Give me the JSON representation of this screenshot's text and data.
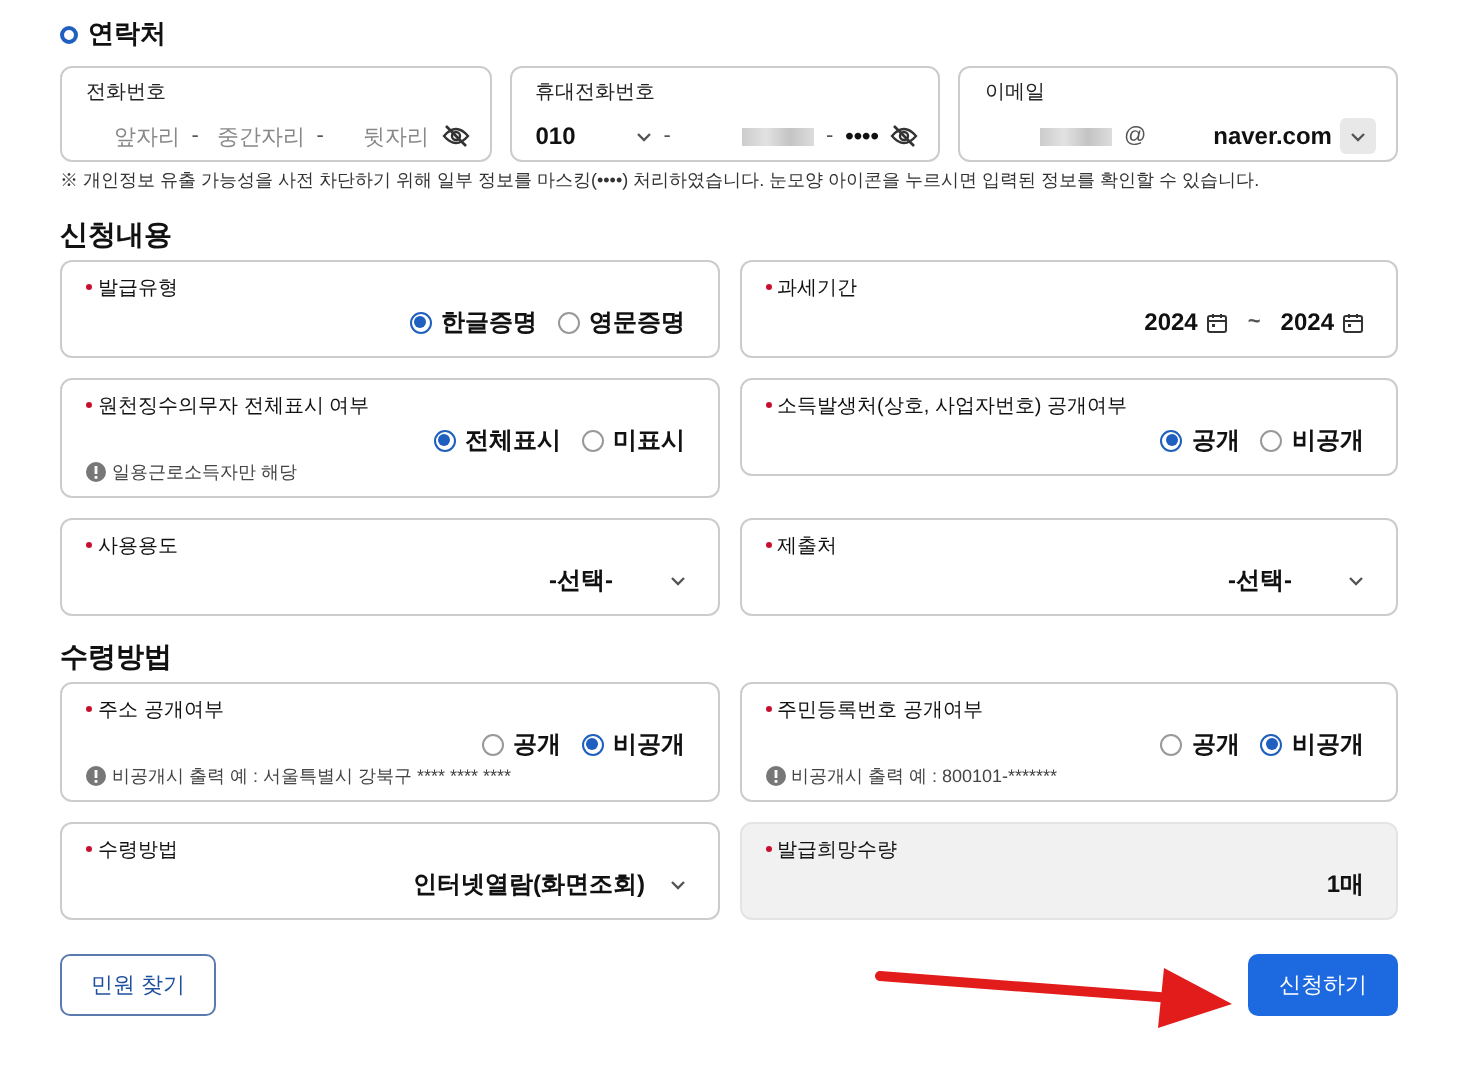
{
  "contact": {
    "title": "연락처",
    "marker": true,
    "fields": [
      {
        "label": "전화번호",
        "segments": [
          {
            "kind": "placeholder",
            "text": "앞자리"
          },
          {
            "kind": "sep",
            "text": "-"
          },
          {
            "kind": "placeholder",
            "text": "중간자리"
          },
          {
            "kind": "sep",
            "text": "-"
          },
          {
            "kind": "placeholder",
            "text": "뒷자리"
          },
          {
            "kind": "eye"
          }
        ]
      },
      {
        "label": "휴대전화번호",
        "segments": [
          {
            "kind": "select",
            "text": "010"
          },
          {
            "kind": "sep",
            "text": "-"
          },
          {
            "kind": "redacted"
          },
          {
            "kind": "sep",
            "text": "-"
          },
          {
            "kind": "value",
            "text": "••••"
          },
          {
            "kind": "eye"
          }
        ]
      },
      {
        "label": "이메일",
        "segments": [
          {
            "kind": "redacted"
          },
          {
            "kind": "sep",
            "text": "@"
          },
          {
            "kind": "domain",
            "text": "naver.com"
          }
        ]
      }
    ],
    "note": "※ 개인정보 유출 가능성을 사전 차단하기 위해 일부 정보를 마스킹(••••) 처리하였습니다. 눈모양 아이콘을 누르시면 입력된 정보를 확인할 수 있습니다."
  },
  "sections": [
    {
      "title": "신청내용",
      "marker": false,
      "cards": [
        {
          "kind": "radio",
          "label": "발급유형",
          "required": true,
          "options": [
            {
              "label": "한글증명",
              "selected": true
            },
            {
              "label": "영문증명",
              "selected": false
            }
          ]
        },
        {
          "kind": "period",
          "label": "과세기간",
          "required": true,
          "from": "2024",
          "sep": "~",
          "to": "2024"
        },
        {
          "kind": "radio",
          "label": "원천징수의무자 전체표시 여부",
          "required": true,
          "options": [
            {
              "label": "전체표시",
              "selected": true
            },
            {
              "label": "미표시",
              "selected": false
            }
          ],
          "note": "일용근로소득자만 해당"
        },
        {
          "kind": "radio",
          "label": "소득발생처(상호, 사업자번호) 공개여부",
          "required": true,
          "options": [
            {
              "label": "공개",
              "selected": true
            },
            {
              "label": "비공개",
              "selected": false
            }
          ]
        },
        {
          "kind": "select",
          "label": "사용용도",
          "required": true,
          "value": "-선택-"
        },
        {
          "kind": "select",
          "label": "제출처",
          "required": true,
          "value": "-선택-"
        }
      ]
    },
    {
      "title": "수령방법",
      "marker": false,
      "cards": [
        {
          "kind": "radio",
          "label": "주소 공개여부",
          "required": true,
          "options": [
            {
              "label": "공개",
              "selected": false
            },
            {
              "label": "비공개",
              "selected": true
            }
          ],
          "note": "비공개시 출력 예 : 서울특별시 강북구 **** **** ****"
        },
        {
          "kind": "radio",
          "label": "주민등록번호 공개여부",
          "required": true,
          "options": [
            {
              "label": "공개",
              "selected": false
            },
            {
              "label": "비공개",
              "selected": true
            }
          ],
          "note": "비공개시 출력 예 : 800101-*******"
        },
        {
          "kind": "select",
          "label": "수령방법",
          "required": true,
          "value": "인터넷열람(화면조회)"
        },
        {
          "kind": "readonly",
          "label": "발급희망수량",
          "required": true,
          "value": "1매"
        }
      ]
    }
  ],
  "buttons": [
    {
      "label": "민원 찾기",
      "kind": "secondary"
    },
    {
      "label": "신청하기",
      "kind": "primary"
    }
  ]
}
